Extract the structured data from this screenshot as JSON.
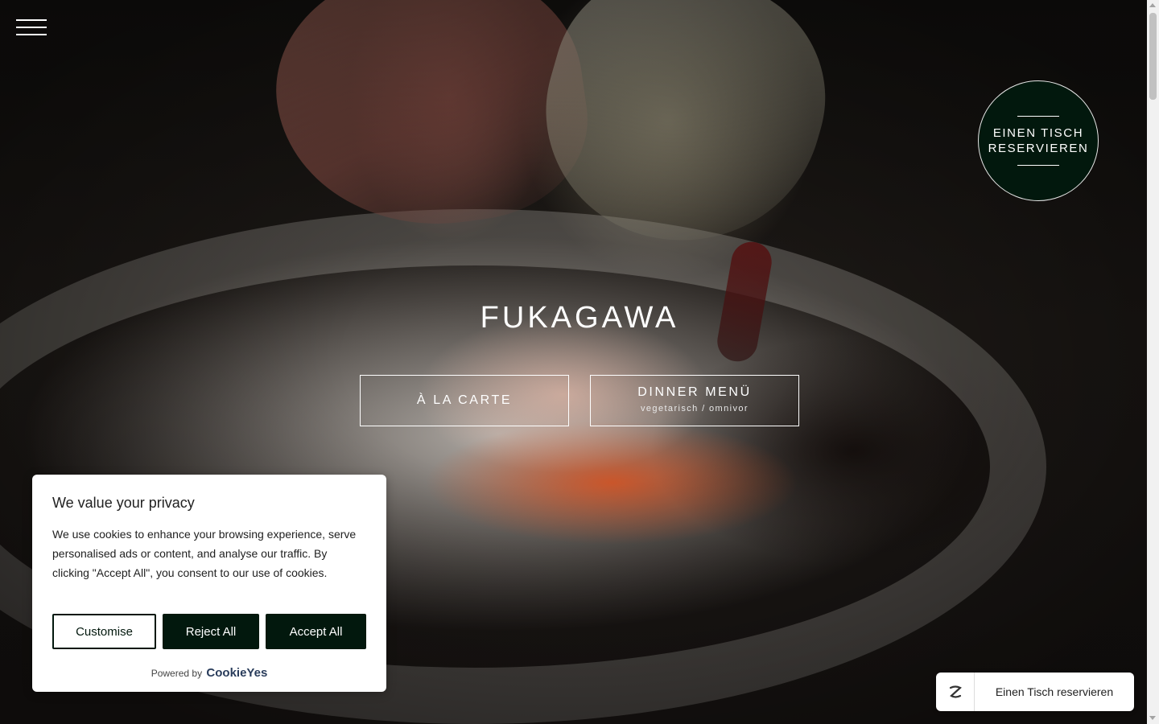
{
  "brand": {
    "name": "FUKAGAWA"
  },
  "reserve_circle": {
    "line1": "EINEN TISCH",
    "line2": "RESERVIEREN"
  },
  "cta": {
    "a_la_carte": "À LA CARTE",
    "dinner": "DINNER MENÜ",
    "dinner_sub": "vegetarisch / omnivor"
  },
  "cookie_banner": {
    "title": "We value your privacy",
    "text": "We use cookies to enhance your browsing experience, serve personalised ads or content, and analyse our traffic. By clicking \"Accept All\", you consent to our use of cookies.",
    "customise": "Customise",
    "reject": "Reject All",
    "accept": "Accept All",
    "powered_by": "Powered by",
    "powered_brand": "CookieYes"
  },
  "booking_widget": {
    "label": "Einen Tisch reservieren",
    "icon": "z-logo-icon"
  },
  "colors": {
    "accent": "#02180d",
    "cookie_brand": "#293C5B"
  }
}
